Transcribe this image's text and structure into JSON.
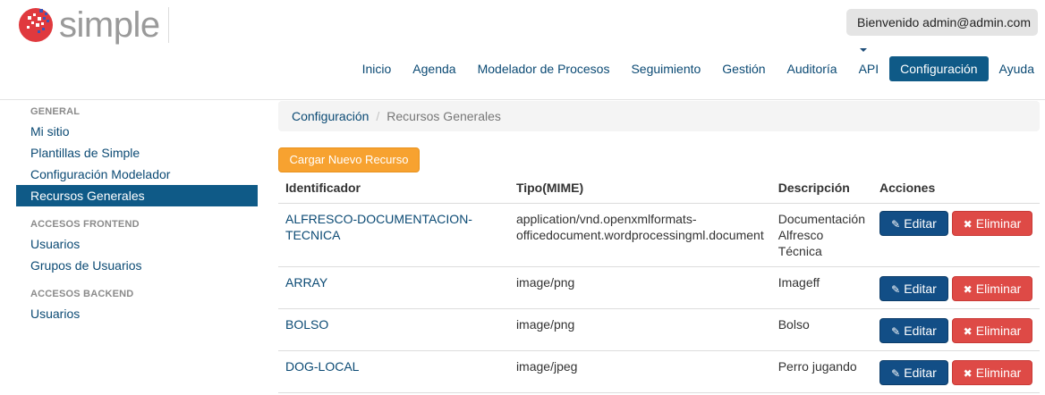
{
  "header": {
    "logo_text": "simple",
    "user_menu_label": "Bienvenido admin@admin.com"
  },
  "nav": {
    "items": [
      {
        "label": "Inicio",
        "active": false
      },
      {
        "label": "Agenda",
        "active": false
      },
      {
        "label": "Modelador de Procesos",
        "active": false
      },
      {
        "label": "Seguimiento",
        "active": false
      },
      {
        "label": "Gestión",
        "active": false
      },
      {
        "label": "Auditoría",
        "active": false
      },
      {
        "label": "API",
        "active": false
      },
      {
        "label": "Configuración",
        "active": true
      },
      {
        "label": "Ayuda",
        "active": false
      }
    ]
  },
  "sidebar": {
    "sections": [
      {
        "title": "GENERAL",
        "items": [
          "Mi sitio",
          "Plantillas de Simple",
          "Configuración Modelador",
          "Recursos Generales"
        ]
      },
      {
        "title": "ACCESOS FRONTEND",
        "items": [
          "Usuarios",
          "Grupos de Usuarios"
        ]
      },
      {
        "title": "ACCESOS BACKEND",
        "items": [
          "Usuarios"
        ]
      }
    ],
    "active_item": "Recursos Generales"
  },
  "breadcrumb": {
    "parent": "Configuración",
    "separator": "/",
    "current": "Recursos Generales"
  },
  "upload_button": "Cargar Nuevo Recurso",
  "table": {
    "headers": [
      "Identificador",
      "Tipo(MIME)",
      "Descripción",
      "Acciones"
    ],
    "rows": [
      {
        "id": "ALFRESCO-DOCUMENTACION-TECNICA",
        "mime_line1": "application/vnd.openxmlformats-",
        "mime_line2": "officedocument.wordprocessingml.document",
        "desc_line1": "Documentación",
        "desc_line2": "Alfresco",
        "desc_line3": "Técnica"
      },
      {
        "id": "ARRAY",
        "mime": "image/png",
        "desc": "Imageff"
      },
      {
        "id": "BOLSO",
        "mime": "image/png",
        "desc": "Bolso"
      },
      {
        "id": "DOG-LOCAL",
        "mime": "image/jpeg",
        "desc": "Perro jugando"
      }
    ],
    "edit_label": "Editar",
    "delete_label": "Eliminar"
  },
  "colors": {
    "primary": "#0f5a87",
    "link": "#0b4a74",
    "edit_button": "#124e86",
    "delete_button": "#de4a46",
    "upload_button": "#f7a230",
    "logo_red": "#e0393e"
  },
  "icons": {
    "edit": "edit-icon",
    "delete": "close-icon",
    "logo": "logo-mark-icon"
  }
}
